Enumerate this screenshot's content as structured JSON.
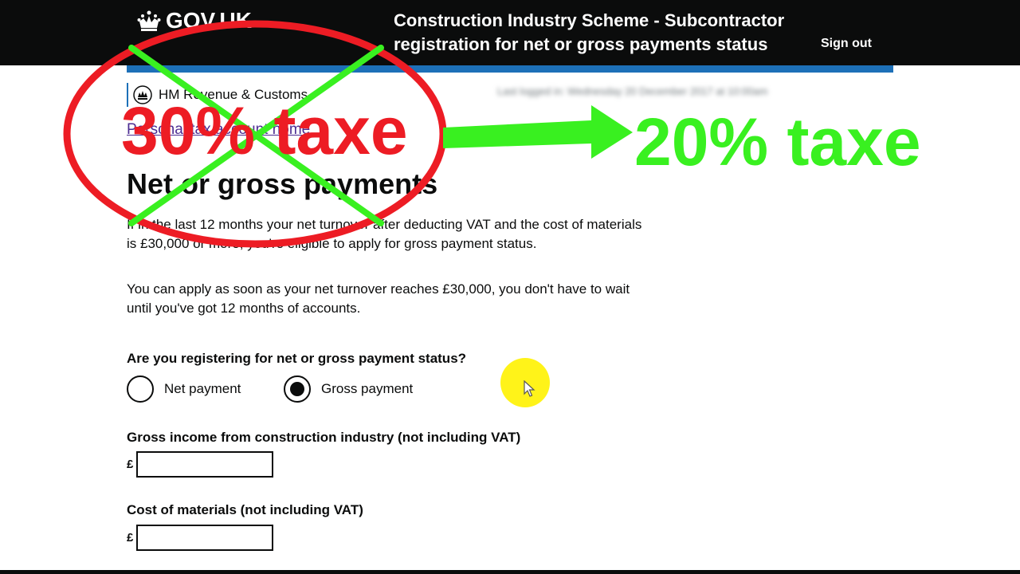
{
  "header": {
    "logo_text": "GOV.UK",
    "service_name": "Construction Industry Scheme - Subcontractor registration for net or gross payments status",
    "sign_out_label": "Sign out"
  },
  "org": {
    "name": "HM Revenue & Customs"
  },
  "breadcrumb": {
    "link_label": "Personal tax account home"
  },
  "page": {
    "title": "Net or gross payments",
    "paragraph1": "If in the last 12 months your net turnover after deducting VAT and the cost of materials is £30,000 or more, you're eligible to apply for gross payment status.",
    "paragraph2": "You can apply as soon as your net turnover reaches £30,000, you don't have to wait until you've got 12 months of accounts."
  },
  "payment_status": {
    "question": "Are you registering for net or gross payment status?",
    "options": [
      {
        "label": "Net payment",
        "selected": false
      },
      {
        "label": "Gross payment",
        "selected": true
      }
    ]
  },
  "fields": {
    "gross_income": {
      "label": "Gross income from construction industry (not including VAT)",
      "prefix": "£",
      "value": ""
    },
    "cost_of_materials": {
      "label": "Cost of materials (not including VAT)",
      "prefix": "£",
      "value": ""
    }
  },
  "annotation": {
    "old_rate": "30% taxe",
    "new_rate": "20% taxe",
    "old_color": "#ed1c24",
    "new_color": "#39f020",
    "cross_color": "#39f020"
  },
  "colors": {
    "header_bg": "#0b0c0c",
    "accent_blue": "#1d70b8",
    "cursor_highlight": "#fff200"
  }
}
